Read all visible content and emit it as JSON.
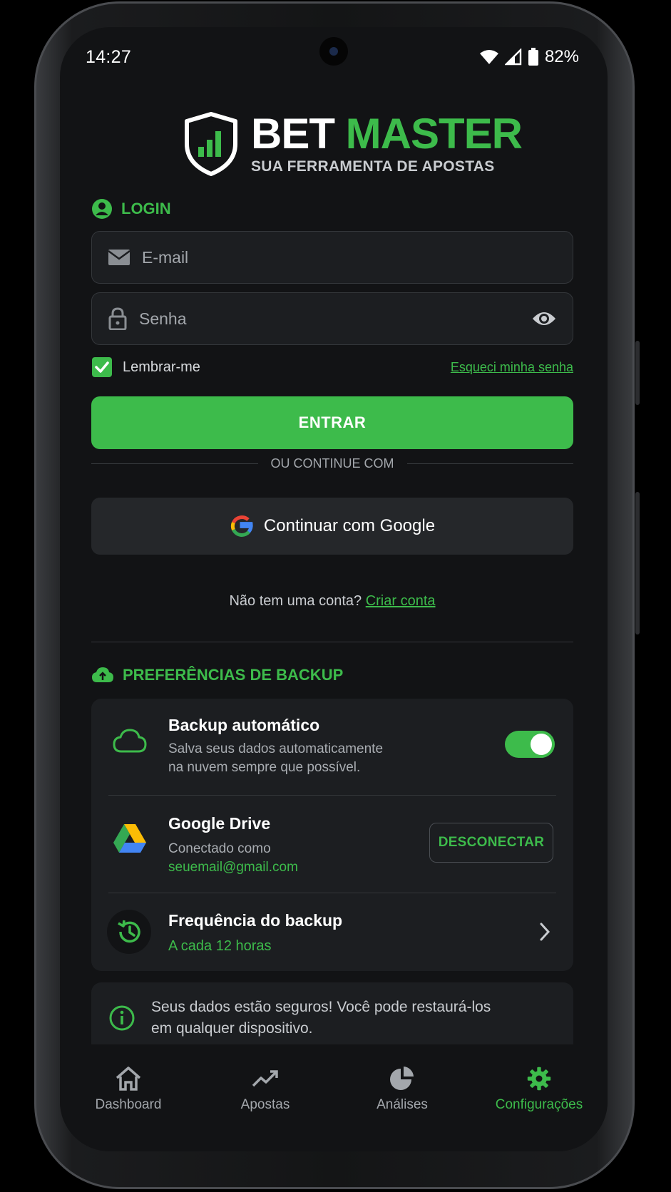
{
  "status": {
    "time": "14:27",
    "battery": "82%"
  },
  "brand": {
    "name_white": "BET",
    "name_green": "MASTER",
    "tagline": "SUA FERRAMENTA DE APOSTAS"
  },
  "login": {
    "section_title": "LOGIN",
    "email_placeholder": "E-mail",
    "password_placeholder": "Senha",
    "remember_label": "Lembrar-me",
    "remember_checked": true,
    "forgot_label": "Esqueci minha senha",
    "submit_label": "ENTRAR",
    "divider_label": "OU CONTINUE COM",
    "google_label": "Continuar com Google",
    "no_account_text": "Não tem uma conta?",
    "create_account_label": "Criar conta"
  },
  "backup": {
    "section_title": "PREFERÊNCIAS DE BACKUP",
    "auto": {
      "title": "Backup automático",
      "line1": "Salva seus dados automaticamente",
      "line2": "na nuvem sempre que possível.",
      "enabled": true
    },
    "drive": {
      "title": "Google Drive",
      "connected_as": "Conectado como",
      "email": "seuemail@gmail.com",
      "disconnect_label": "DESCONECTAR"
    },
    "frequency": {
      "title": "Frequência do backup",
      "value": "A cada 12 horas"
    },
    "info": {
      "line1": "Seus dados estão seguros! Você pode restaurá-los",
      "line2": "em qualquer dispositivo."
    }
  },
  "nav": {
    "items": [
      {
        "label": "Dashboard",
        "icon": "home-icon"
      },
      {
        "label": "Apostas",
        "icon": "trend-icon"
      },
      {
        "label": "Análises",
        "icon": "pie-chart-icon"
      },
      {
        "label": "Configurações",
        "icon": "gear-icon"
      }
    ],
    "active": "Configurações"
  },
  "colors": {
    "accent": "#3dbb4b",
    "background": "#121315",
    "card": "#1c1e21"
  }
}
